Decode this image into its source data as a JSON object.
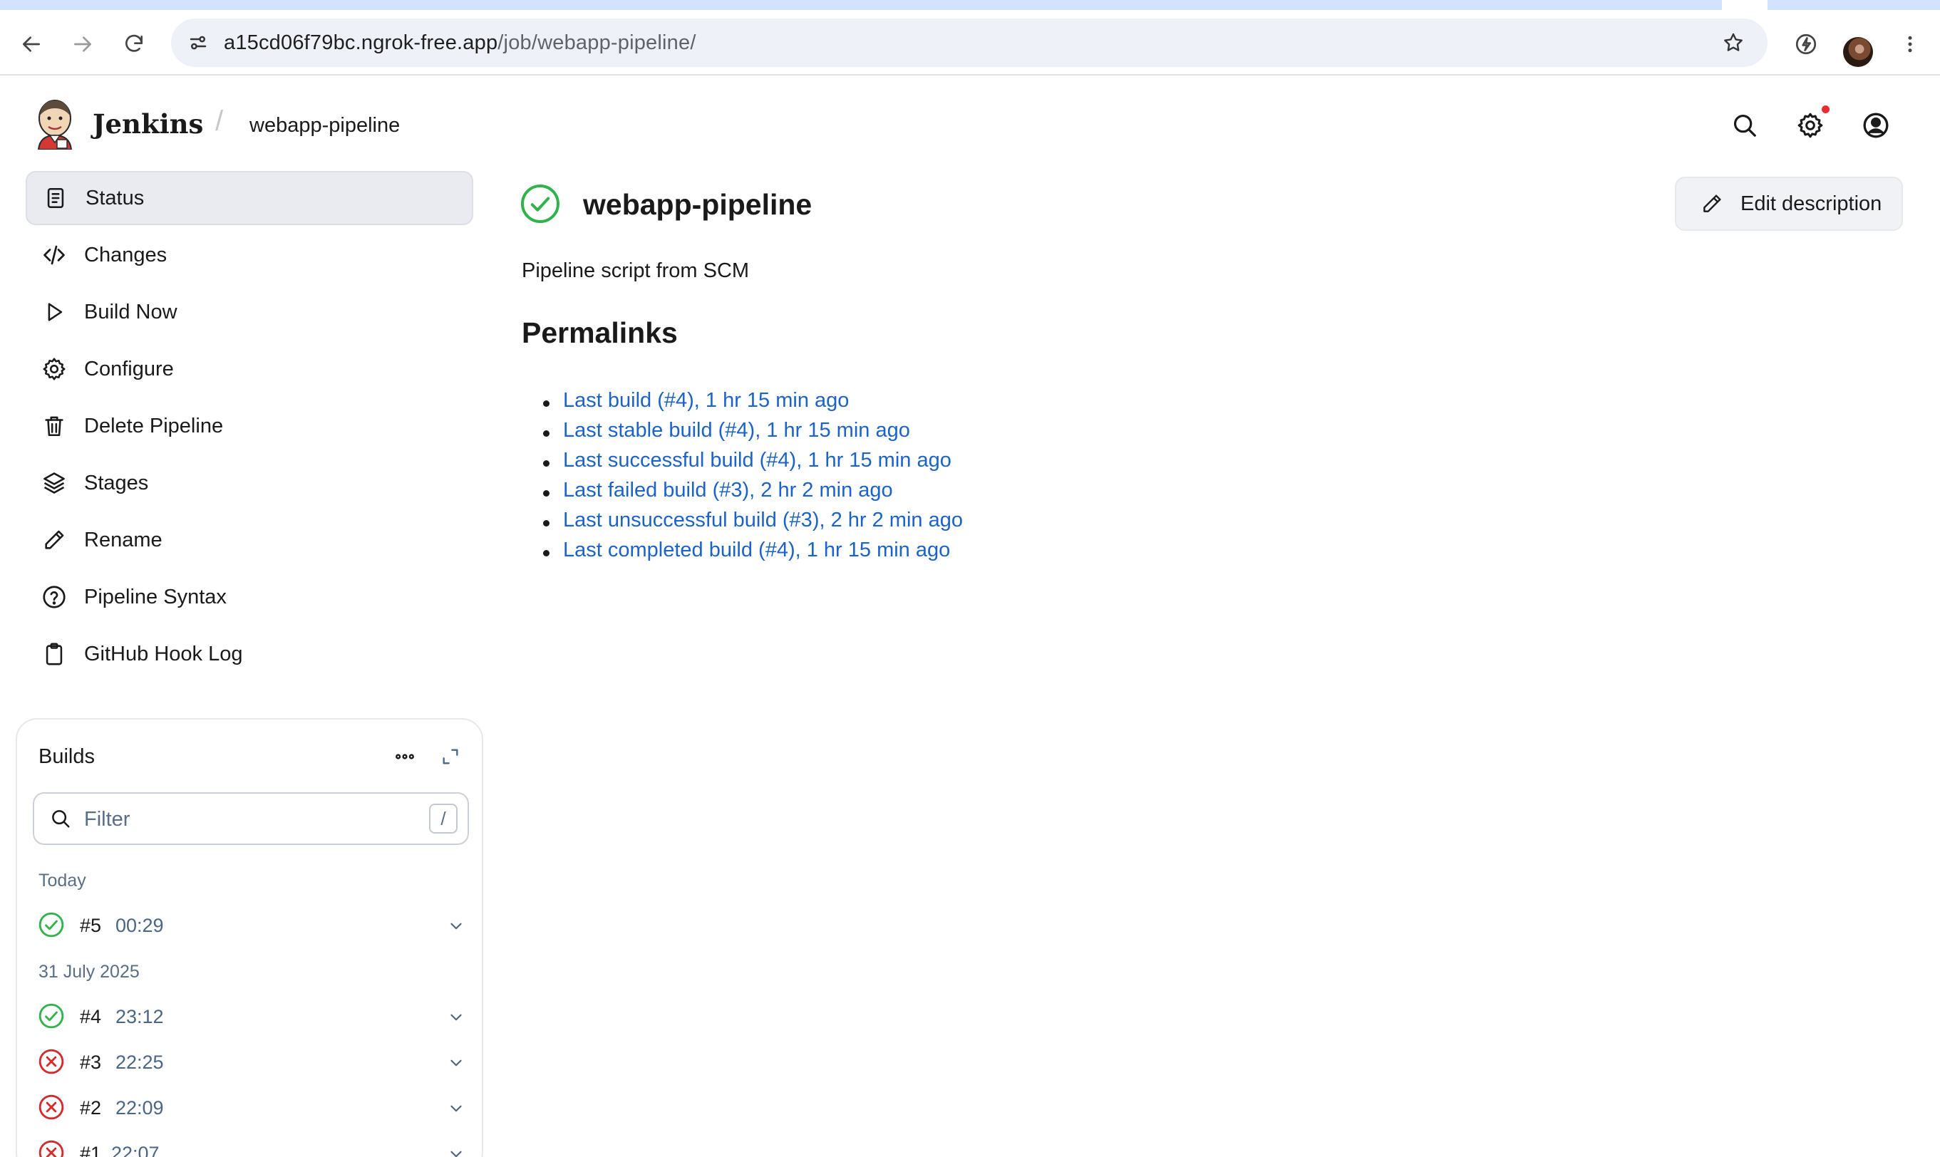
{
  "browser": {
    "url_host": "a15cd06f79bc.ngrok-free.app",
    "url_path": "/job/webapp-pipeline/"
  },
  "header": {
    "brand": "Jenkins",
    "breadcrumb_separator": "/",
    "breadcrumb": "webapp-pipeline"
  },
  "sidebar": {
    "items": [
      {
        "label": "Status",
        "icon": "document-icon"
      },
      {
        "label": "Changes",
        "icon": "code-icon"
      },
      {
        "label": "Build Now",
        "icon": "play-icon"
      },
      {
        "label": "Configure",
        "icon": "gear-icon"
      },
      {
        "label": "Delete Pipeline",
        "icon": "trash-icon"
      },
      {
        "label": "Stages",
        "icon": "layers-icon"
      },
      {
        "label": "Rename",
        "icon": "pencil-icon"
      },
      {
        "label": "Pipeline Syntax",
        "icon": "help-icon"
      },
      {
        "label": "GitHub Hook Log",
        "icon": "clipboard-icon"
      }
    ]
  },
  "builds": {
    "title": "Builds",
    "filter_placeholder": "Filter",
    "filter_shortcut": "/",
    "groups": [
      {
        "label": "Today"
      },
      {
        "label": "31 July 2025"
      }
    ],
    "rows": [
      {
        "number": "#5",
        "time": "00:29",
        "status": "success"
      },
      {
        "number": "#4",
        "time": "23:12",
        "status": "success"
      },
      {
        "number": "#3",
        "time": "22:25",
        "status": "failed"
      },
      {
        "number": "#2",
        "time": "22:09",
        "status": "failed"
      },
      {
        "number": "#1",
        "time": "22:07",
        "status": "failed"
      }
    ]
  },
  "main": {
    "title": "webapp-pipeline",
    "status": "success",
    "edit_label": "Edit description",
    "description": "Pipeline script from SCM",
    "permalinks_heading": "Permalinks",
    "permalinks": [
      "Last build (#4), 1 hr 15 min ago",
      "Last stable build (#4), 1 hr 15 min ago",
      "Last successful build (#4), 1 hr 15 min ago",
      "Last failed build (#3), 2 hr 2 min ago",
      "Last unsuccessful build (#3), 2 hr 2 min ago",
      "Last completed build (#4), 1 hr 15 min ago"
    ]
  },
  "colors": {
    "success": "#2fb34a",
    "failed": "#d42a2a",
    "link": "#1c63c9",
    "muted": "#5a6e87"
  }
}
